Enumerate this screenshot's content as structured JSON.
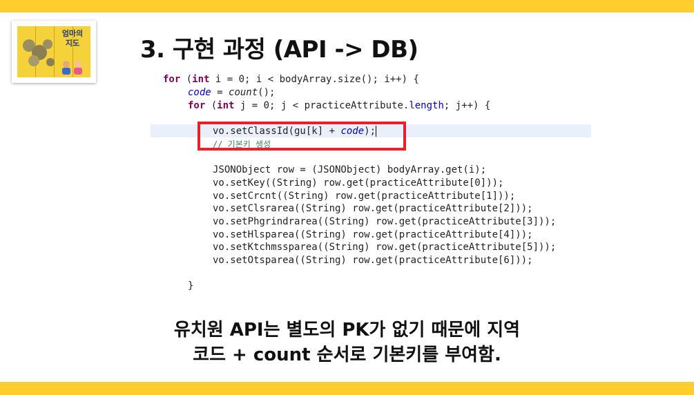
{
  "slide": {
    "title": "3. 구현 과정 (API -> DB)",
    "logo_text": "엄마의 지도"
  },
  "code": {
    "l1_for": "for",
    "l1_paren": " (",
    "l1_int": "int",
    "l1_rest": " i = 0; i < bodyArray.size(); i++) {",
    "l2_code": "code",
    "l2_eq": " = ",
    "l2_count": "count",
    "l2_rest": "();",
    "l3_for": "for",
    "l3_paren": " (",
    "l3_int": "int",
    "l3_mid": " j = 0; j < practiceAttribute.",
    "l3_length": "length",
    "l3_rest": "; j++) {",
    "l4_pre": "vo.setClassId(gu[k] + ",
    "l4_code": "code",
    "l4_post": ");",
    "l5_comment": "// 기본키 생성",
    "l6": "JSONObject row = (JSONObject) bodyArray.get(i);",
    "l7": "vo.setKey((String) row.get(practiceAttribute[0]));",
    "l8": "vo.setCrcnt((String) row.get(practiceAttribute[1]));",
    "l9": "vo.setClsrarea((String) row.get(practiceAttribute[2]));",
    "l10": "vo.setPhgrindrarea((String) row.get(practiceAttribute[3]));",
    "l11": "vo.setHlsparea((String) row.get(practiceAttribute[4]));",
    "l12": "vo.setKtchmssparea((String) row.get(practiceAttribute[5]));",
    "l13": "vo.setOtsparea((String) row.get(practiceAttribute[6]));",
    "l14": "}"
  },
  "caption": {
    "line1": "유치원 API는 별도의 PK가 없기 때문에 지역",
    "line2": "코드 + count 순서로 기본키를 부여함."
  },
  "colors": {
    "accent_bar": "#ffcd2e",
    "highlight_box": "#e8202a",
    "keyword": "#7f0055",
    "field": "#0000c0",
    "comment": "#3f7f5f"
  }
}
